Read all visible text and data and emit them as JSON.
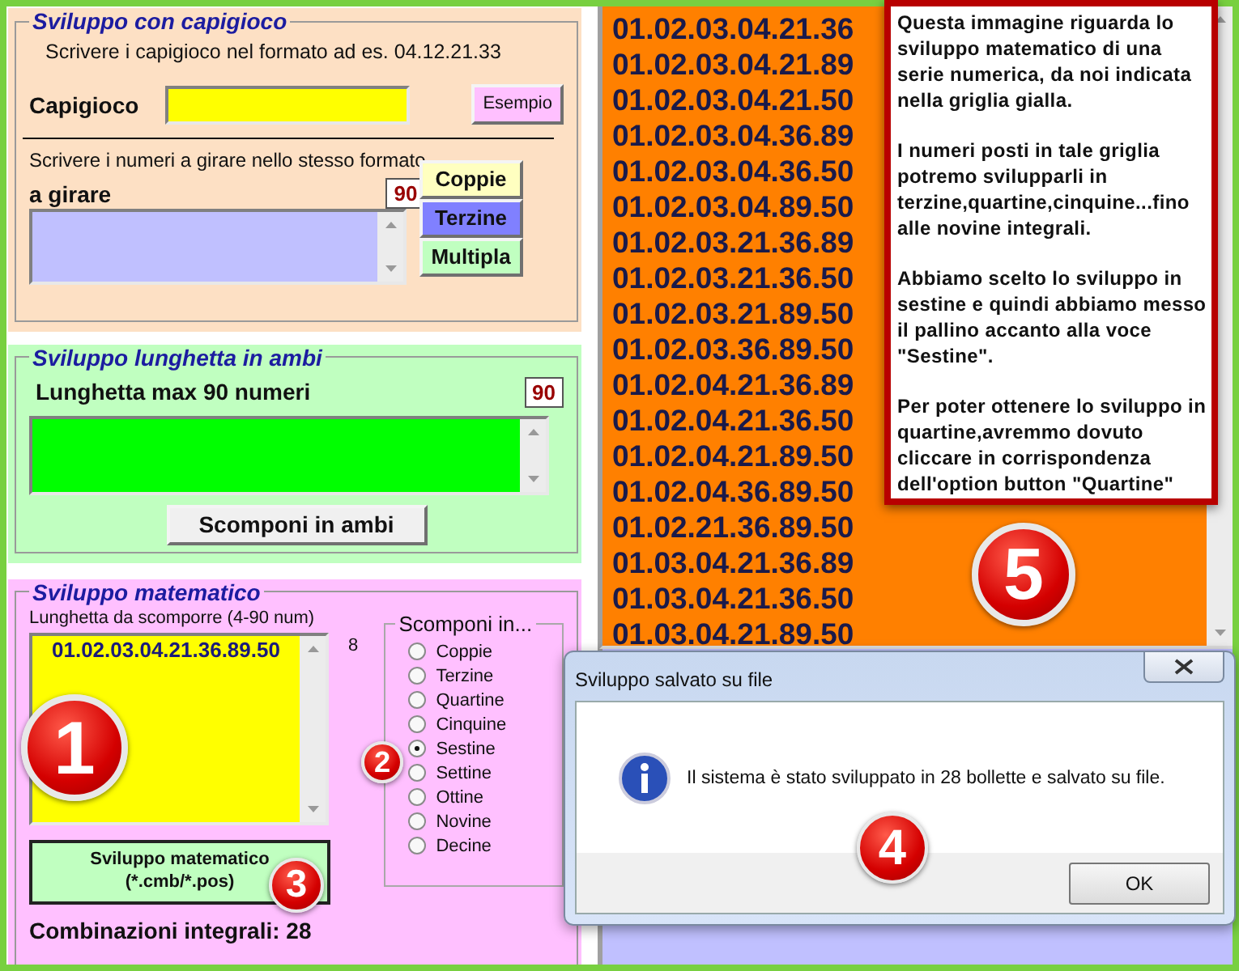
{
  "capigioco": {
    "legend": "Sviluppo con capigioco",
    "instruction": "Scrivere i capigioco nel formato ad es. 04.12.21.33",
    "field_label": "Capigioco",
    "example_button": "Esempio",
    "girare_instruction": "Scrivere i numeri a girare nello stesso formato",
    "girare_label": "a girare",
    "count": "90",
    "buttons": [
      {
        "label": "Coppie",
        "color": "#ffffc0"
      },
      {
        "label": "Terzine",
        "color": "#8080ff"
      },
      {
        "label": "Multipla",
        "color": "#c0ffc0"
      }
    ]
  },
  "lunghetta": {
    "legend": "Sviluppo lunghetta in ambi",
    "label": "Lunghetta max 90 numeri",
    "count": "90",
    "button": "Scomponi in ambi"
  },
  "matematico": {
    "legend": "Sviluppo matematico",
    "label": "Lunghetta da scomporre (4-90 num)",
    "value": "01.02.03.04.21.36.89.50",
    "count": "8",
    "button_lines": [
      "Sviluppo matematico",
      "(*.cmb/*.pos)"
    ],
    "result": "Combinazioni integrali: 28",
    "radio_legend": "Scomponi in...",
    "options": [
      {
        "label": "Coppie",
        "selected": false
      },
      {
        "label": "Terzine",
        "selected": false
      },
      {
        "label": "Quartine",
        "selected": false
      },
      {
        "label": "Cinquine",
        "selected": false
      },
      {
        "label": "Sestine",
        "selected": true
      },
      {
        "label": "Settine",
        "selected": false
      },
      {
        "label": "Ottine",
        "selected": false
      },
      {
        "label": "Novine",
        "selected": false
      },
      {
        "label": "Decine",
        "selected": false
      }
    ]
  },
  "results": [
    "01.02.03.04.21.36",
    "01.02.03.04.21.89",
    "01.02.03.04.21.50",
    "01.02.03.04.36.89",
    "01.02.03.04.36.50",
    "01.02.03.04.89.50",
    "01.02.03.21.36.89",
    "01.02.03.21.36.50",
    "01.02.03.21.89.50",
    "01.02.03.36.89.50",
    "01.02.04.21.36.89",
    "01.02.04.21.36.50",
    "01.02.04.21.89.50",
    "01.02.04.36.89.50",
    "01.02.21.36.89.50",
    "01.03.04.21.36.89",
    "01.03.04.21.36.50",
    "01.03.04.21.89.50"
  ],
  "callout": [
    "Questa immagine riguarda lo sviluppo matematico di una serie numerica, da noi indicata nella griglia gialla.",
    "I numeri posti in tale griglia potremo svilupparli in terzine,quartine,cinquine...fino alle novine integrali.",
    "Abbiamo scelto lo sviluppo in sestine e quindi abbiamo messo il pallino accanto alla voce \"Sestine\".",
    "Per poter ottenere lo sviluppo in quartine,avremmo dovuto cliccare in corrispondenza dell'option button \"Quartine\""
  ],
  "dialog": {
    "title": "Sviluppo salvato su file",
    "message": "Il sistema è stato sviluppato in 28 bollette e salvato su file.",
    "button": "OK"
  },
  "badges": [
    "1",
    "2",
    "3",
    "4",
    "5"
  ]
}
